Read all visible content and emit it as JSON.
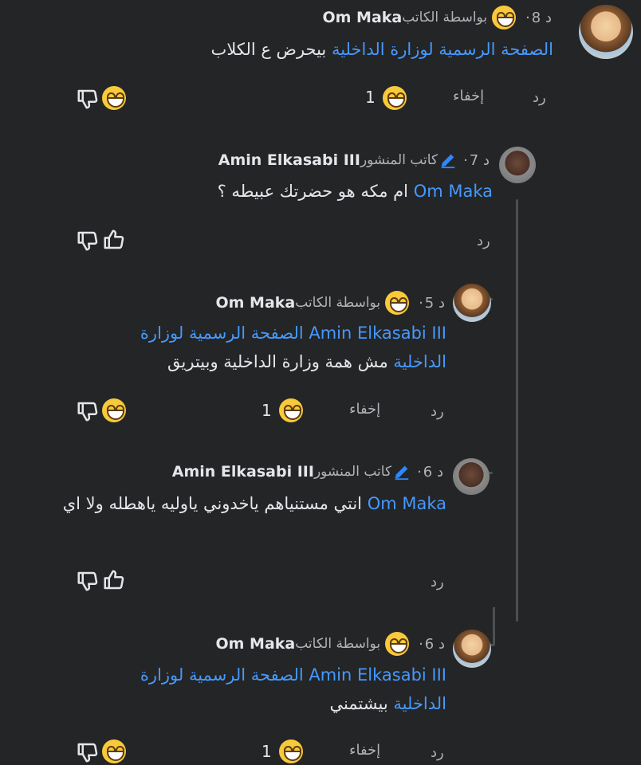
{
  "comments": [
    {
      "id": "c1",
      "time": "8 د",
      "via": "بواسطة الكاتب",
      "name": "Om Maka",
      "mention": "الصفحة الرسمية لوزارة الداخلية",
      "text": " بيحرض ع الكلاب",
      "reply": "رد",
      "hide": "إخفاء",
      "count": "1"
    },
    {
      "id": "c2",
      "time": "7 د",
      "via": "كاتب المنشور",
      "name": "Amin Elkasabi III",
      "mention": "Om Maka",
      "text": " ام مكه هو حضرتك عبيطه ؟",
      "reply": "رد"
    },
    {
      "id": "c3",
      "time": "5 د",
      "via": "بواسطة الكاتب",
      "name": "Om Maka",
      "mention": "Amin Elkasabi III الصفحة الرسمية لوزارة الداخلية",
      "text": " مش همة وزارة الداخلية وبيتريق",
      "reply": "رد",
      "hide": "إخفاء",
      "count": "1"
    },
    {
      "id": "c4",
      "time": "6 د",
      "via": "كاتب المنشور",
      "name": "Amin Elkasabi III",
      "mention": "Om Maka",
      "text": " انتي مستنياهم ياخدوني ياوليه ياهطله ولا اي",
      "reply": "رد"
    },
    {
      "id": "c5",
      "time": "6 د",
      "via": "بواسطة الكاتب",
      "name": "Om Maka",
      "mention": "Amin Elkasabi III الصفحة الرسمية لوزارة الداخلية",
      "text": " بيشتمني",
      "reply": "رد",
      "hide": "إخفاء",
      "count": "1"
    }
  ],
  "separator": "·",
  "icons": {
    "dislike": "thumbs-down-icon",
    "like": "thumbs-up-icon",
    "grin": "grinning-emoji-icon",
    "pen": "pencil-icon"
  },
  "colors": {
    "background": "#242526",
    "mention": "#4599ff",
    "secondary_text": "#b0b3b8",
    "emoji": "#f8c93b",
    "pen": "#2d88ff"
  }
}
